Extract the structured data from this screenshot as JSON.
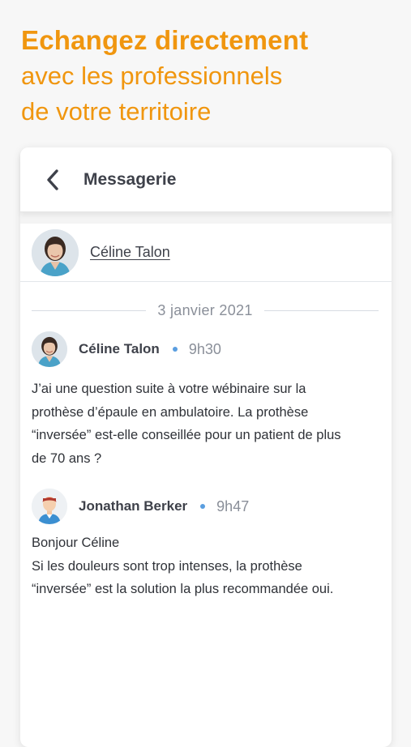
{
  "hero": {
    "title": "Echangez directement",
    "line2": "avec les professionnels",
    "line3": "de votre territoire"
  },
  "header": {
    "back_icon": "chevron-left-icon",
    "title": "Messagerie"
  },
  "contact": {
    "name": "Céline Talon"
  },
  "conversation": {
    "date": "3 janvier 2021",
    "messages": [
      {
        "author": "Céline Talon",
        "time": "9h30",
        "lines": [
          "J’ai une question suite à votre wébinaire sur la",
          "prothèse d’épaule en ambulatoire. La prothèse",
          "“inversée” est-elle conseillée pour un patient de plus",
          "de 70 ans ?"
        ]
      },
      {
        "author": "Jonathan Berker",
        "time": "9h47",
        "lines": [
          "Bonjour Céline",
          "Si les douleurs sont trop intenses, la prothèse",
          "“inversée” est la solution la plus recommandée oui."
        ]
      }
    ]
  },
  "colors": {
    "accent": "#f0960f",
    "text": "#3e414a",
    "muted": "#8a8f99",
    "dot": "#5a9ee0"
  }
}
